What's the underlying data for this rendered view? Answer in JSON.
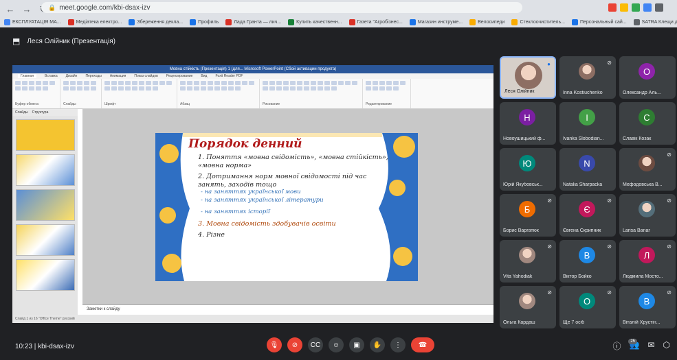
{
  "browser": {
    "url": "meet.google.com/kbi-dsax-izv",
    "bookmarks": [
      {
        "label": "ЕКСПЛУАТАЦІЯ МА...",
        "color": "#4285f4"
      },
      {
        "label": "Медіатека електро...",
        "color": "#d93025"
      },
      {
        "label": "Збереження декла...",
        "color": "#1a73e8"
      },
      {
        "label": "Профиль",
        "color": "#1a73e8"
      },
      {
        "label": "Лада Гранта — лич...",
        "color": "#d93025"
      },
      {
        "label": "Купить качественн...",
        "color": "#188038"
      },
      {
        "label": "Газета \"Агробізнес...",
        "color": "#d93025"
      },
      {
        "label": "Магазин инструме...",
        "color": "#1a73e8"
      },
      {
        "label": "Велосипеди",
        "color": "#f9ab00"
      },
      {
        "label": "Стеклоочиститель...",
        "color": "#f9ab00"
      },
      {
        "label": "Персональный сай...",
        "color": "#1a73e8"
      },
      {
        "label": "SATRA Клещи для...",
        "color": "#5f6368"
      },
      {
        "label": "Інші закла...",
        "color": "#f9ab00"
      }
    ]
  },
  "meeting": {
    "presenter_title": "Леся Олійник (Презентація)",
    "code_display": "10:23  |  kbi-dsax-izv",
    "people_count": "25"
  },
  "ppt": {
    "window_title": "Мовна стійкість (Презентація) 1 (для... Microsoft PowerPoint (Сбой активации продукта)",
    "tabs": [
      "Главная",
      "Вставка",
      "Дизайн",
      "Переходы",
      "Анимация",
      "Показ слайдов",
      "Рецензирование",
      "Вид",
      "Foxit Reader PDF"
    ],
    "pane_tabs": [
      "Слайды",
      "Структура"
    ],
    "ribbon_groups": [
      "Буфер обмена",
      "Слайды",
      "Шрифт",
      "Абзац",
      "Рисование",
      "Редактирование"
    ],
    "notes_label": "Заметки к слайду",
    "status_left": "Слайд 1 из 16   \"Office Theme\"   русский"
  },
  "slide": {
    "title": "Порядок денний",
    "items": [
      {
        "text": "1. Поняття «мовна свідомість», «мовна стійкість», «мовна норма»",
        "subs": []
      },
      {
        "text": "2. Дотримання норм мовної свідомості під час занять, заходів тощо",
        "subs": [
          "- на заняттях української мови",
          "- на заняттях української літератури",
          "- на заняттях історії"
        ]
      },
      {
        "text": "3. Мовна  свідомість здобувачів освіти",
        "subs": []
      },
      {
        "text": "4. Різне",
        "subs": []
      }
    ]
  },
  "participants": [
    {
      "name": "Леся Олійник",
      "initial": "",
      "color": "#8d6e63",
      "photo": true
    },
    {
      "name": "Inna Kostiuchenko",
      "initial": "",
      "color": "#8d6e63",
      "photo": true
    },
    {
      "name": "Олександр Аль...",
      "initial": "О",
      "color": "#8e24aa"
    },
    {
      "name": "Новоушицький ф...",
      "initial": "Н",
      "color": "#7b1fa2"
    },
    {
      "name": "Ivanka Slobodian...",
      "initial": "I",
      "color": "#43a047"
    },
    {
      "name": "Славік Козак",
      "initial": "С",
      "color": "#2e7d32"
    },
    {
      "name": "Юрій Якубовськ...",
      "initial": "Ю",
      "color": "#00897b"
    },
    {
      "name": "Natalia Sharpacka",
      "initial": "N",
      "color": "#3949ab"
    },
    {
      "name": "Мефодовська В...",
      "initial": "",
      "color": "#6d4c41",
      "photo": true
    },
    {
      "name": "Борис Варгатюк",
      "initial": "Б",
      "color": "#ef6c00"
    },
    {
      "name": "Євгена Скрипник",
      "initial": "Є",
      "color": "#c2185b"
    },
    {
      "name": "Larisa Banar",
      "initial": "",
      "color": "#546e7a",
      "photo": true
    },
    {
      "name": "Vita Yahodiak",
      "initial": "",
      "color": "#a1887f",
      "photo": true
    },
    {
      "name": "Віктор Бойко",
      "initial": "В",
      "color": "#1e88e5"
    },
    {
      "name": "Людмила Мосто...",
      "initial": "Л",
      "color": "#c2185b"
    },
    {
      "name": "Ольга Кардаш",
      "initial": "",
      "color": "#a1887f",
      "photo": true
    },
    {
      "name": "Ще 7 осіб",
      "initial": "O",
      "color": "#00897b"
    },
    {
      "name": "Віталій Хрустін...",
      "initial": "В",
      "color": "#1e88e5"
    }
  ]
}
